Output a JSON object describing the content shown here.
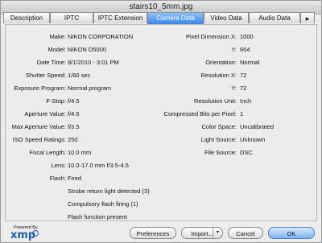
{
  "window": {
    "title": "stairs10_5mm.jpg"
  },
  "tabs": [
    {
      "label": "Description"
    },
    {
      "label": "IPTC"
    },
    {
      "label": "IPTC Extension"
    },
    {
      "label": "Camera Data"
    },
    {
      "label": "Video Data"
    },
    {
      "label": "Audio Data"
    },
    {
      "label": "▸"
    }
  ],
  "left_fields": [
    {
      "label": "Make:",
      "value": "NIKON CORPORATION"
    },
    {
      "label": "Model:",
      "value": "NIKON D5000"
    },
    {
      "label": "Date Time:",
      "value": "9/1/2010 - 3:01 PM"
    },
    {
      "label": "Shutter Speed:",
      "value": "1/60 sec"
    },
    {
      "label": "Exposure Program:",
      "value": "Normal program"
    },
    {
      "label": "F-Stop:",
      "value": "f/4.5"
    },
    {
      "label": "Aperture Value:",
      "value": "f/4.5"
    },
    {
      "label": "Max Aperture Value:",
      "value": "f/3.5"
    },
    {
      "label": "ISO Speed Ratings:",
      "value": "250"
    },
    {
      "label": "Focal Length:",
      "value": "10.0 mm"
    },
    {
      "label": "Lens:",
      "value": "10.0-17.0 mm f/3.5-4.5"
    },
    {
      "label": "Flash:",
      "value": "Fired"
    }
  ],
  "flash_details": [
    "Strobe return light detected (3)",
    "Compulsory flash firing (1)",
    "Flash function present"
  ],
  "right_fields": [
    {
      "label": "Pixel Dimension X:",
      "value": "1000"
    },
    {
      "label": "Y:",
      "value": "664"
    },
    {
      "label": "Orientation:",
      "value": "Normal"
    },
    {
      "label": "Resolution X:",
      "value": "72"
    },
    {
      "label": "Y:",
      "value": "72"
    },
    {
      "label": "Resolution Unit:",
      "value": "Inch"
    },
    {
      "label": "Compressed Bits per Pixel:",
      "value": "1"
    },
    {
      "label": "Color Space:",
      "value": "Uncalibrated"
    },
    {
      "label": "Light Source:",
      "value": "Unknown"
    },
    {
      "label": "File Source:",
      "value": "DSC"
    }
  ],
  "footer": {
    "powered_by": "Powered By",
    "xmp": "xmp",
    "buttons": {
      "preferences": "Preferences",
      "import": "Import...",
      "cancel": "Cancel",
      "ok": "OK"
    }
  }
}
